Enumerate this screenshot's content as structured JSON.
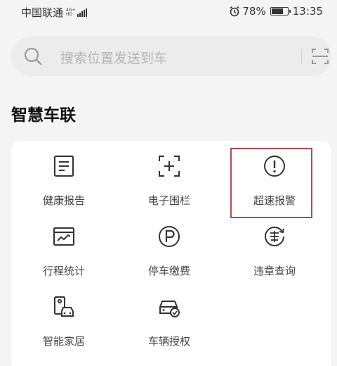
{
  "status_bar": {
    "carrier": "中国联通",
    "network_tag_top": "4G+",
    "network_tag_bottom": "HD",
    "battery_percent": "78%",
    "battery_level": 0.78,
    "time": "13:35"
  },
  "search": {
    "placeholder": "搜索位置发送到车",
    "icon": "search-icon",
    "scan_icon": "scan-icon"
  },
  "section": {
    "title": "智慧车联"
  },
  "grid": {
    "items": [
      {
        "label": "健康报告",
        "icon": "report-icon"
      },
      {
        "label": "电子围栏",
        "icon": "geofence-icon"
      },
      {
        "label": "超速报警",
        "icon": "alert-icon",
        "highlighted": true
      },
      {
        "label": "行程统计",
        "icon": "trip-chart-icon"
      },
      {
        "label": "停车缴费",
        "icon": "parking-icon"
      },
      {
        "label": "违章查询",
        "icon": "violation-icon"
      },
      {
        "label": "智能家居",
        "icon": "smart-home-icon"
      },
      {
        "label": "车辆授权",
        "icon": "car-auth-icon"
      }
    ]
  },
  "colors": {
    "background": "#f4f4f4",
    "card": "#ffffff",
    "icon_stroke": "#333333",
    "highlight_border": "#b04a52",
    "placeholder_text": "#b5b5b5"
  }
}
